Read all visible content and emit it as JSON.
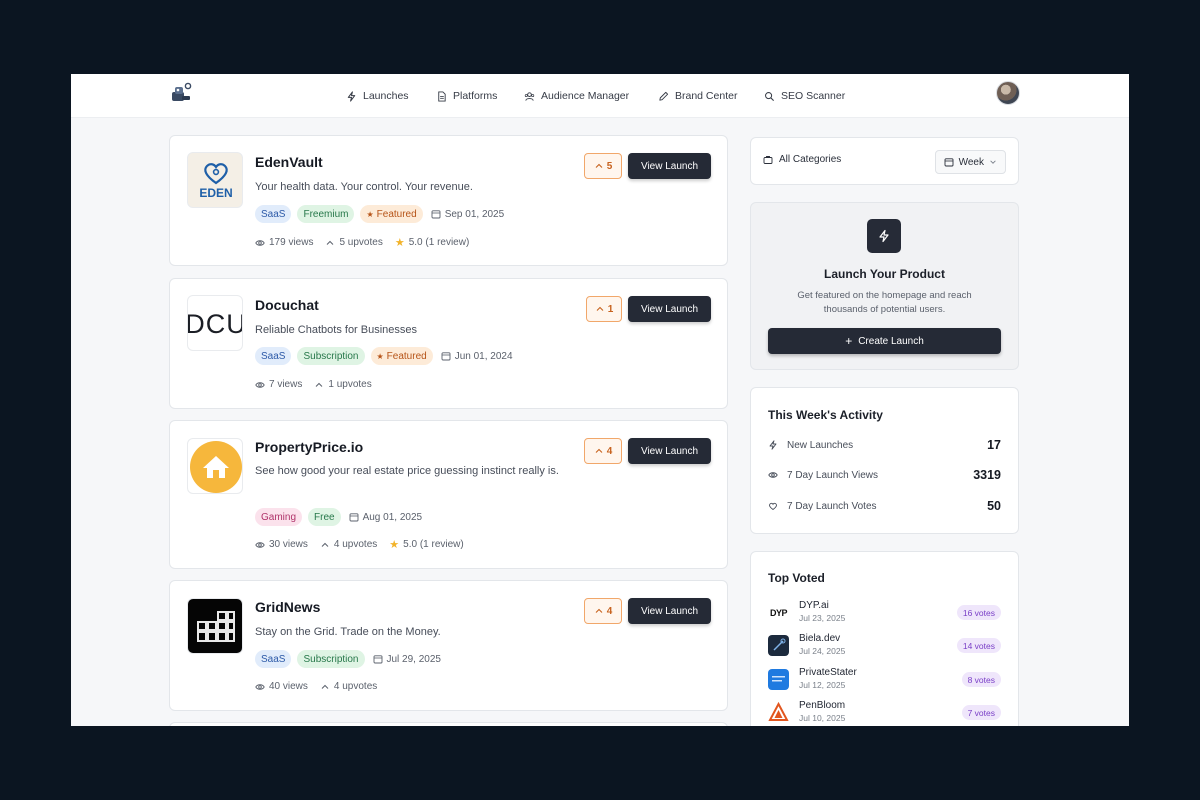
{
  "nav": {
    "items": [
      {
        "label": "Launches",
        "icon": "bolt-icon"
      },
      {
        "label": "Platforms",
        "icon": "document-icon"
      },
      {
        "label": "Audience Manager",
        "icon": "users-icon"
      },
      {
        "label": "Brand Center",
        "icon": "pencil-icon"
      },
      {
        "label": "SEO Scanner",
        "icon": "search-icon"
      }
    ]
  },
  "launches": [
    {
      "title": "EdenVault",
      "logo_text": "EDEN",
      "description": "Your health data. Your control. Your revenue.",
      "tags": [
        "SaaS",
        "Freemium",
        "Featured"
      ],
      "date": "Sep 01, 2025",
      "views": "179 views",
      "upvotes": "5 upvotes",
      "rating": "5.0 (1 review)",
      "vote_count": "5",
      "button": "View Launch"
    },
    {
      "title": "Docuchat",
      "logo_text": "DCU",
      "description": "Reliable Chatbots for Businesses",
      "tags": [
        "SaaS",
        "Subscription",
        "Featured"
      ],
      "date": "Jun 01, 2024",
      "views": "7 views",
      "upvotes": "1 upvotes",
      "vote_count": "1",
      "button": "View Launch"
    },
    {
      "title": "PropertyPrice.io",
      "description": "See how good your real estate price guessing instinct really is.",
      "tags": [
        "Gaming",
        "Free"
      ],
      "date": "Aug 01, 2025",
      "views": "30 views",
      "upvotes": "4 upvotes",
      "rating": "5.0 (1 review)",
      "vote_count": "4",
      "button": "View Launch"
    },
    {
      "title": "GridNews",
      "description": "Stay on the Grid. Trade on the Money.",
      "tags": [
        "SaaS",
        "Subscription"
      ],
      "date": "Jul 29, 2025",
      "views": "40 views",
      "upvotes": "4 upvotes",
      "vote_count": "4",
      "button": "View Launch"
    }
  ],
  "filters": {
    "category": "All Categories",
    "period": "Week"
  },
  "promo": {
    "title": "Launch Your Product",
    "description": "Get featured on the homepage and reach thousands of potential users.",
    "button": "Create Launch"
  },
  "activity": {
    "title": "This Week's Activity",
    "rows": [
      {
        "label": "New Launches",
        "value": "17",
        "icon": "bolt-icon"
      },
      {
        "label": "7 Day Launch Views",
        "value": "3319",
        "icon": "eye-icon"
      },
      {
        "label": "7 Day Launch Votes",
        "value": "50",
        "icon": "heart-icon"
      }
    ]
  },
  "top_voted": {
    "title": "Top Voted",
    "items": [
      {
        "name": "DYP.ai",
        "date": "Jul 23, 2025",
        "votes": "16 votes",
        "logo_text": "DYP"
      },
      {
        "name": "Biela.dev",
        "date": "Jul 24, 2025",
        "votes": "14 votes"
      },
      {
        "name": "PrivateStater",
        "date": "Jul 12, 2025",
        "votes": "8 votes"
      },
      {
        "name": "PenBloom",
        "date": "Jul 10, 2025",
        "votes": "7 votes"
      }
    ]
  },
  "colors": {
    "accent_dark": "#252a36",
    "upvote_orange": "#c7621e",
    "vote_badge_purple": "#7a3fc7"
  }
}
